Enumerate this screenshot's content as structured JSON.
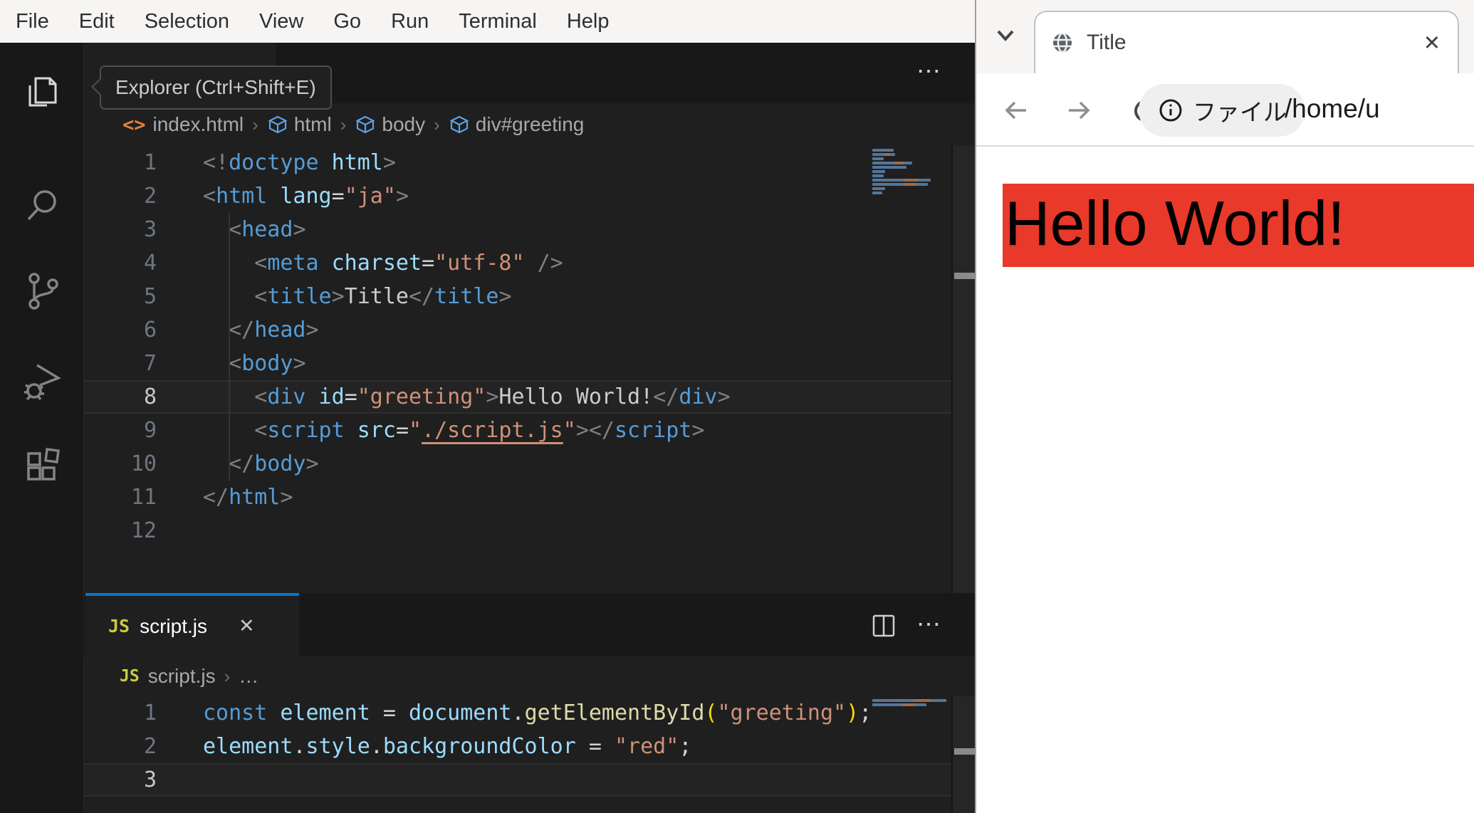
{
  "colors": {
    "accent_blue": "#0078d4",
    "red_banner": "#e8392a",
    "editor_bg": "#1f1f1f",
    "menu_bg": "#f6f5f4"
  },
  "menu_bar": {
    "items": [
      "File",
      "Edit",
      "Selection",
      "View",
      "Go",
      "Run",
      "Terminal",
      "Help"
    ]
  },
  "activity_bar": {
    "tooltip": "Explorer (Ctrl+Shift+E)",
    "icons": [
      "explorer-icon",
      "search-icon",
      "source-control-icon",
      "run-debug-icon",
      "extensions-icon"
    ]
  },
  "editor_html": {
    "actions_more": "⋯",
    "breadcrumb": {
      "file_icon": "<>",
      "file": "index.html",
      "path": [
        "html",
        "body",
        "div#greeting"
      ]
    },
    "current_line": 8,
    "lines": [
      [
        [
          "p",
          "<!"
        ],
        [
          "tag",
          "doctype"
        ],
        [
          "attr",
          " html"
        ],
        [
          "p",
          ">"
        ]
      ],
      [
        [
          "p",
          "<"
        ],
        [
          "tag",
          "html"
        ],
        [
          "attr",
          " lang"
        ],
        [
          "op",
          "="
        ],
        [
          "str",
          "\"ja\""
        ],
        [
          "p",
          ">"
        ]
      ],
      [
        [
          "txt",
          "  "
        ],
        [
          "p",
          "<"
        ],
        [
          "tag",
          "head"
        ],
        [
          "p",
          ">"
        ]
      ],
      [
        [
          "txt",
          "    "
        ],
        [
          "p",
          "<"
        ],
        [
          "tag",
          "meta"
        ],
        [
          "attr",
          " charset"
        ],
        [
          "op",
          "="
        ],
        [
          "str",
          "\"utf-8\""
        ],
        [
          "p",
          " />"
        ]
      ],
      [
        [
          "txt",
          "    "
        ],
        [
          "p",
          "<"
        ],
        [
          "tag",
          "title"
        ],
        [
          "p",
          ">"
        ],
        [
          "txt",
          "Title"
        ],
        [
          "p",
          "</"
        ],
        [
          "tag",
          "title"
        ],
        [
          "p",
          ">"
        ]
      ],
      [
        [
          "txt",
          "  "
        ],
        [
          "p",
          "</"
        ],
        [
          "tag",
          "head"
        ],
        [
          "p",
          ">"
        ]
      ],
      [
        [
          "txt",
          "  "
        ],
        [
          "p",
          "<"
        ],
        [
          "tag",
          "body"
        ],
        [
          "p",
          ">"
        ]
      ],
      [
        [
          "txt",
          "    "
        ],
        [
          "p",
          "<"
        ],
        [
          "tag",
          "div"
        ],
        [
          "attr",
          " id"
        ],
        [
          "op",
          "="
        ],
        [
          "str",
          "\"greeting\""
        ],
        [
          "p",
          ">"
        ],
        [
          "txt",
          "Hello World!"
        ],
        [
          "p",
          "</"
        ],
        [
          "tag",
          "div"
        ],
        [
          "p",
          ">"
        ]
      ],
      [
        [
          "txt",
          "    "
        ],
        [
          "p",
          "<"
        ],
        [
          "tag",
          "script"
        ],
        [
          "attr",
          " src"
        ],
        [
          "op",
          "="
        ],
        [
          "str",
          "\""
        ],
        [
          "link",
          "./script.js"
        ],
        [
          "str",
          "\""
        ],
        [
          "p",
          ">"
        ],
        [
          "p",
          "</"
        ],
        [
          "tag",
          "script"
        ],
        [
          "p",
          ">"
        ]
      ],
      [
        [
          "txt",
          "  "
        ],
        [
          "p",
          "</"
        ],
        [
          "tag",
          "body"
        ],
        [
          "p",
          ">"
        ]
      ],
      [
        [
          "p",
          "</"
        ],
        [
          "tag",
          "html"
        ],
        [
          "p",
          ">"
        ]
      ],
      []
    ]
  },
  "editor_js": {
    "tab": {
      "badge": "JS",
      "label": "script.js",
      "close": "✕"
    },
    "actions_split": "split-editor-icon",
    "actions_more": "⋯",
    "breadcrumb": {
      "badge": "JS",
      "file": "script.js",
      "more": "…"
    },
    "current_line": 3,
    "lines": [
      [
        [
          "kw",
          "const"
        ],
        [
          "attr",
          " element"
        ],
        [
          "op",
          " = "
        ],
        [
          "attr",
          "document"
        ],
        [
          "op",
          "."
        ],
        [
          "fn",
          "getElementById"
        ],
        [
          "gold",
          "("
        ],
        [
          "str",
          "\"greeting\""
        ],
        [
          "gold",
          ")"
        ],
        [
          "op",
          ";"
        ]
      ],
      [
        [
          "attr",
          "element"
        ],
        [
          "op",
          "."
        ],
        [
          "attr",
          "style"
        ],
        [
          "op",
          "."
        ],
        [
          "attr",
          "backgroundColor"
        ],
        [
          "op",
          " = "
        ],
        [
          "str",
          "\"red\""
        ],
        [
          "op",
          ";"
        ]
      ],
      []
    ]
  },
  "browser": {
    "tab": {
      "title": "Title",
      "close": "✕"
    },
    "toolbar": {
      "chip_label": "ファイル",
      "url": "/home/u"
    },
    "page": {
      "heading": "Hello World!"
    }
  }
}
